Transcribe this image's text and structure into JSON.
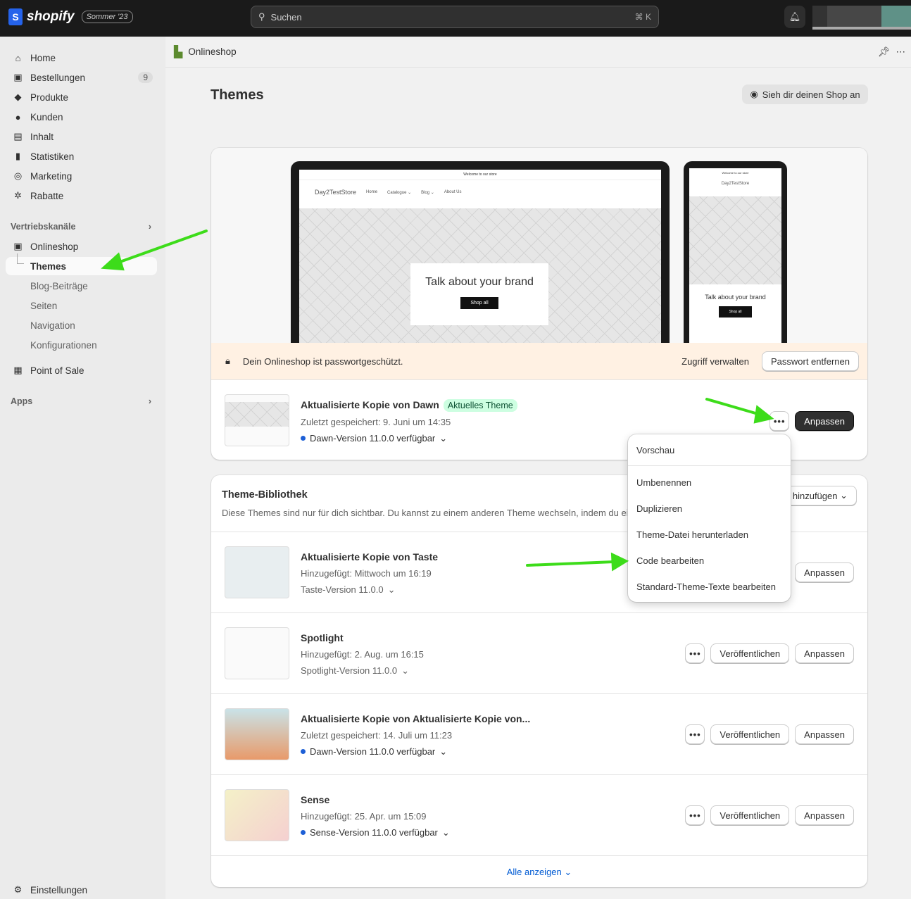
{
  "topbar": {
    "brand": "shopify",
    "edition": "Sommer '23",
    "search_placeholder": "Suchen",
    "shortcut": "⌘ K"
  },
  "sidebar": {
    "items": [
      {
        "label": "Home",
        "icon": "home-icon",
        "glyph": "⌂"
      },
      {
        "label": "Bestellungen",
        "icon": "orders-icon",
        "glyph": "▣",
        "badge": "9"
      },
      {
        "label": "Produkte",
        "icon": "tag-icon",
        "glyph": "◆"
      },
      {
        "label": "Kunden",
        "icon": "person-icon",
        "glyph": "●"
      },
      {
        "label": "Inhalt",
        "icon": "content-icon",
        "glyph": "▤"
      },
      {
        "label": "Statistiken",
        "icon": "bar-chart-icon",
        "glyph": "▮"
      },
      {
        "label": "Marketing",
        "icon": "target-icon",
        "glyph": "◎"
      },
      {
        "label": "Rabatte",
        "icon": "discount-icon",
        "glyph": "✲"
      }
    ],
    "sales_channels": "Vertriebskanäle",
    "onlineshop": "Onlineshop",
    "sub": [
      "Themes",
      "Blog-Beiträge",
      "Seiten",
      "Navigation",
      "Konfigurationen"
    ],
    "pos": "Point of Sale",
    "apps": "Apps",
    "settings": "Einstellungen"
  },
  "breadcrumb": "Onlineshop",
  "page": {
    "title": "Themes",
    "view_shop": "Sieh dir deinen Shop an"
  },
  "preview": {
    "announcement": "Welcome to our store",
    "store": "Day2TestStore",
    "nav": [
      "Home",
      "Catalogue ⌄",
      "Blog ⌄",
      "About Us"
    ],
    "hero": "Talk about your brand",
    "cta": "Shop all"
  },
  "banner": {
    "text": "Dein Onlineshop ist passwortgeschützt.",
    "manage": "Zugriff verwalten",
    "remove": "Passwort entfernen"
  },
  "current": {
    "name": "Aktualisierte Kopie von Dawn",
    "badge": "Aktuelles Theme",
    "saved": "Zuletzt gespeichert: 9. Juni um 14:35",
    "version": "Dawn-Version 11.0.0 verfügbar",
    "customize": "Anpassen"
  },
  "menu": [
    "Vorschau",
    "Umbenennen",
    "Duplizieren",
    "Theme-Datei herunterladen",
    "Code bearbeiten",
    "Standard-Theme-Texte bearbeiten"
  ],
  "library": {
    "title": "Theme-Bibliothek",
    "desc": "Diese Themes sind nur für dich sichtbar. Du kannst zu einem anderen Theme wechseln, indem du eines deiner Themes veröffentlichst.",
    "add": "Theme hinzufügen",
    "show_all": "Alle anzeigen",
    "themes": [
      {
        "name": "Aktualisierte Kopie von Taste",
        "sub": "Hinzugefügt: Mittwoch um 16:19",
        "version": "Taste-Version 11.0.0",
        "update": false
      },
      {
        "name": "Spotlight",
        "sub": "Hinzugefügt: 2. Aug. um 16:15",
        "version": "Spotlight-Version 11.0.0",
        "update": false
      },
      {
        "name": "Aktualisierte Kopie von Aktualisierte Kopie von...",
        "sub": "Zuletzt gespeichert: 14. Juli um 11:23",
        "version": "Dawn-Version 11.0.0 verfügbar",
        "update": true
      },
      {
        "name": "Sense",
        "sub": "Hinzugefügt: 25. Apr. um 15:09",
        "version": "Sense-Version 11.0.0 verfügbar",
        "update": true
      }
    ],
    "publish": "Veröffentlichen",
    "customize": "Anpassen"
  },
  "colors": {
    "topbar": "#1a1a1a",
    "accent_arrow": "#3ddc1a",
    "badge_bg": "#cdfee1",
    "link": "#005bd3"
  }
}
